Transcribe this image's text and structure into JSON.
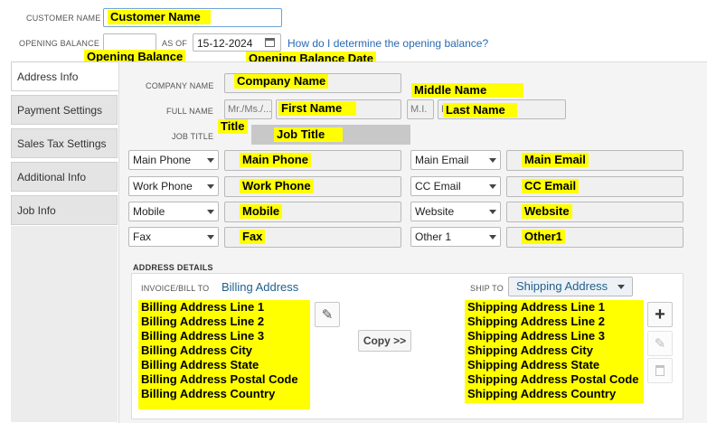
{
  "header": {
    "customer_name_label": "CUSTOMER NAME",
    "customer_name_value": "Customer Name",
    "opening_balance_label": "OPENING BALANCE",
    "opening_balance_highlight": "Opening Balance",
    "as_of_label": "AS OF",
    "as_of_date": "15-12-2024",
    "as_of_highlight": "Opening  Balance Date",
    "help_link": "How do I determine the opening balance?"
  },
  "tabs": [
    {
      "label": "Address Info"
    },
    {
      "label": "Payment Settings"
    },
    {
      "label": "Sales Tax Settings"
    },
    {
      "label": "Additional Info"
    },
    {
      "label": "Job Info"
    }
  ],
  "form": {
    "company_name_label": "COMPANY NAME",
    "company_name_value": "Company Name",
    "middle_name_highlight": "Middle Name",
    "full_name_label": "FULL NAME",
    "title_placeholder": "Mr./Ms./...",
    "title_highlight": "Title",
    "first_name_value": "First Name",
    "mi_placeholder": "M.I.",
    "last_name_prefix": "L",
    "last_name_value": "Last Name",
    "job_title_label": "JOB TITLE",
    "job_title_value": "Job Title"
  },
  "contacts": {
    "left": [
      {
        "type": "Main Phone",
        "value": "Main Phone"
      },
      {
        "type": "Work Phone",
        "value": "Work Phone"
      },
      {
        "type": "Mobile",
        "value": "Mobile"
      },
      {
        "type": "Fax",
        "value": "Fax"
      }
    ],
    "right": [
      {
        "type": "Main Email",
        "value": "Main Email"
      },
      {
        "type": "CC Email",
        "value": "CC Email"
      },
      {
        "type": "Website",
        "value": "Website"
      },
      {
        "type": "Other 1",
        "value": "Other1"
      }
    ]
  },
  "address": {
    "section_label": "ADDRESS DETAILS",
    "bill_to_label": "INVOICE/BILL TO",
    "bill_to_title": "Billing Address",
    "ship_to_label": "SHIP TO",
    "ship_to_select": "Shipping Address",
    "copy_button": "Copy >>",
    "billing_lines": [
      "Billing Address Line 1",
      "Billing Address Line 2",
      "Billing Address Line 3",
      "Billing Address City",
      "Billing Address State",
      "Billing Address Postal Code",
      "Billing Address Country"
    ],
    "shipping_lines": [
      "Shipping Address Line 1",
      "Shipping Address Line 2",
      "Shipping Address Line 3",
      "Shipping Address City",
      "Shipping Address State",
      "Shipping Address Postal Code",
      "Shipping Address Country"
    ]
  },
  "colors": {
    "highlight": "#ffff00",
    "link": "#2a6ab3",
    "accent_blue": "#1f5f8b"
  }
}
